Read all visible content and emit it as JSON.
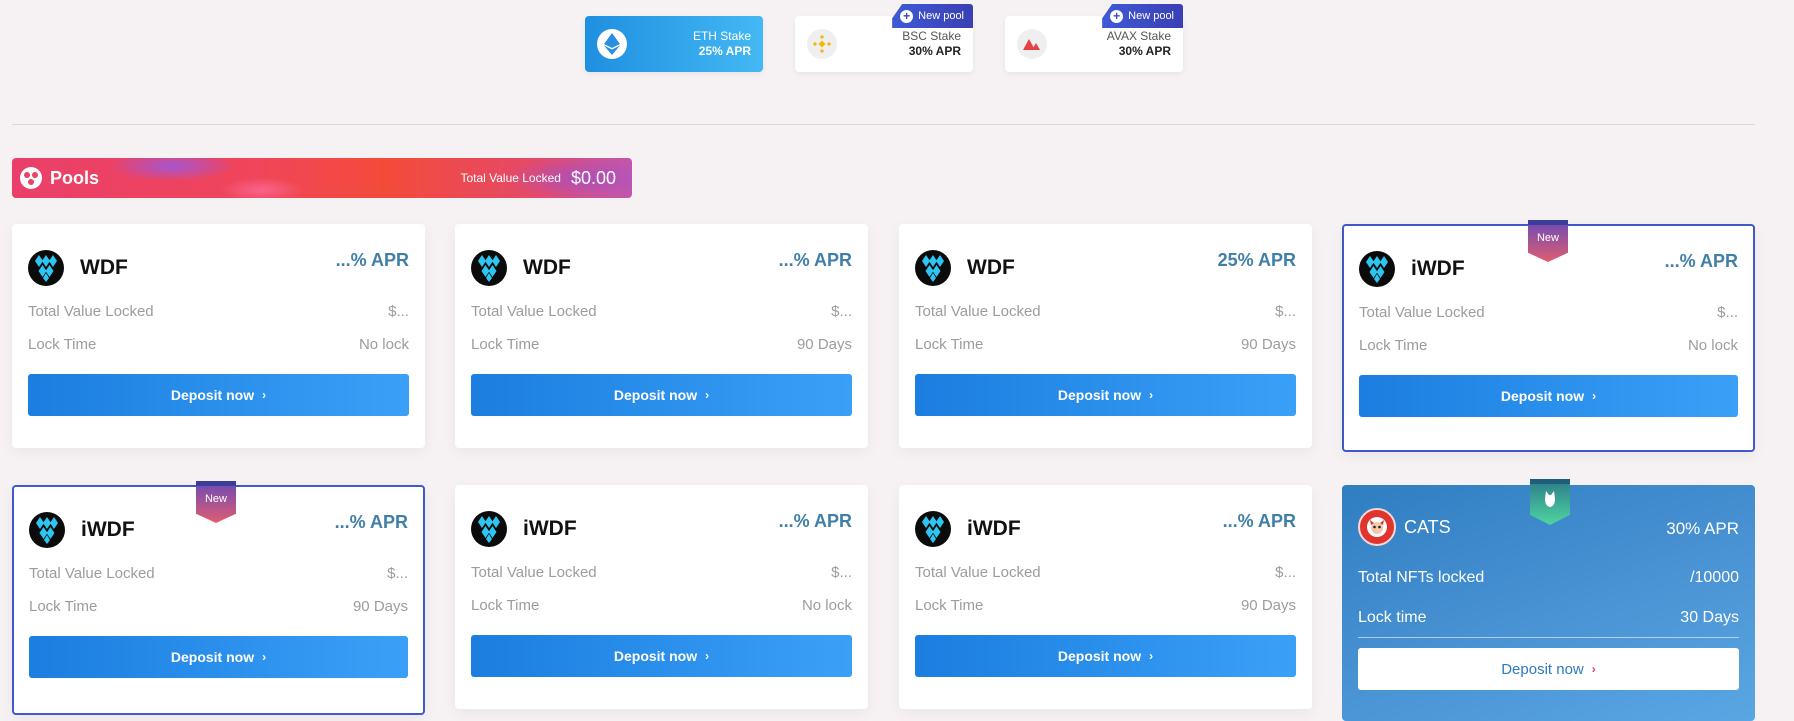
{
  "chain_tabs": [
    {
      "name": "ETH Stake",
      "apr": "25% APR",
      "active": true,
      "icon": "ethereum-icon"
    },
    {
      "name": "BSC Stake",
      "apr": "30% APR",
      "active": false,
      "icon": "binance-icon",
      "tag": "New pool"
    },
    {
      "name": "AVAX Stake",
      "apr": "30% APR",
      "active": false,
      "icon": "avalanche-icon",
      "tag": "New pool"
    }
  ],
  "pools_banner": {
    "title": "Pools",
    "tvl_label": "Total Value Locked",
    "tvl_value": "$0.00"
  },
  "cards": [
    {
      "token": "WDF",
      "apr": "...% APR",
      "tvl_label": "Total Value Locked",
      "tvl": "$...",
      "lock_label": "Lock Time",
      "lock": "No lock",
      "button": "Deposit now"
    },
    {
      "token": "WDF",
      "apr": "...% APR",
      "tvl_label": "Total Value Locked",
      "tvl": "$...",
      "lock_label": "Lock Time",
      "lock": "90 Days",
      "button": "Deposit now"
    },
    {
      "token": "WDF",
      "apr": "25% APR",
      "tvl_label": "Total Value Locked",
      "tvl": "$...",
      "lock_label": "Lock Time",
      "lock": "90 Days",
      "button": "Deposit now"
    },
    {
      "token": "iWDF",
      "apr": "...% APR",
      "tvl_label": "Total Value Locked",
      "tvl": "$...",
      "lock_label": "Lock Time",
      "lock": "No lock",
      "button": "Deposit now",
      "ribbon": "New"
    },
    {
      "token": "iWDF",
      "apr": "...% APR",
      "tvl_label": "Total Value Locked",
      "tvl": "$...",
      "lock_label": "Lock Time",
      "lock": "90 Days",
      "button": "Deposit now",
      "ribbon": "New"
    },
    {
      "token": "iWDF",
      "apr": "...% APR",
      "tvl_label": "Total Value Locked",
      "tvl": "$...",
      "lock_label": "Lock Time",
      "lock": "No lock",
      "button": "Deposit now"
    },
    {
      "token": "iWDF",
      "apr": "...% APR",
      "tvl_label": "Total Value Locked",
      "tvl": "$...",
      "lock_label": "Lock Time",
      "lock": "90 Days",
      "button": "Deposit now"
    }
  ],
  "cats_card": {
    "token": "CATS",
    "apr": "30% APR",
    "nft_label": "Total NFTs locked",
    "nft_value": "/10000",
    "lock_label": "Lock time",
    "lock_value": "30 Days",
    "button": "Deposit now"
  },
  "colors": {
    "accent_blue": "#1b7ee0",
    "apr_text": "#3f7fa8",
    "highlight_border": "#4059c9",
    "banner_red": "#f0455a"
  }
}
